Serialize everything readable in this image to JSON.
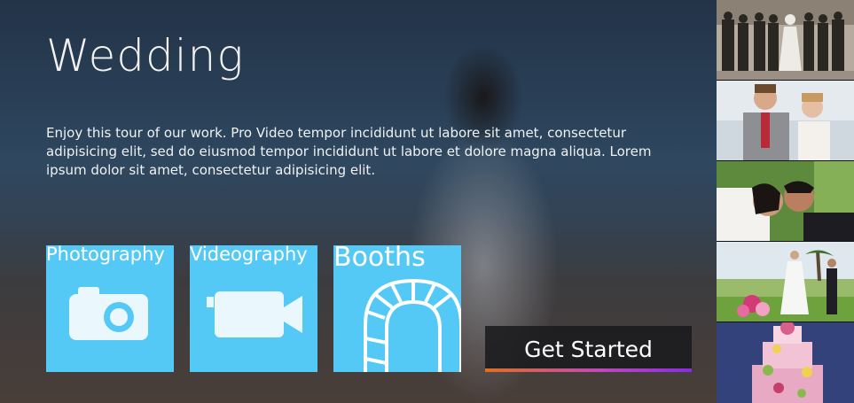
{
  "hero": {
    "title": "Wedding",
    "description": "Enjoy this tour of our work. Pro Video tempor incididunt ut labore sit amet, consectetur adipisicing elit, sed do eiusmod tempor incididunt ut labore et dolore magna aliqua. Lorem ipsum dolor sit amet, consectetur adipisicing elit."
  },
  "tiles": [
    {
      "label": "Photography",
      "icon": "camera-icon"
    },
    {
      "label": "Videography",
      "icon": "video-camera-icon"
    },
    {
      "label": "Booths",
      "icon": "arch-icon"
    }
  ],
  "cta": {
    "label": "Get Started"
  },
  "colors": {
    "tile": "#55c9f6",
    "cta_bar_start": "#e0701e",
    "cta_bar_end": "#8a2be2"
  },
  "thumbnails": [
    "vintage-wedding-group-photo",
    "couple-portrait-photo",
    "couple-kiss-photo",
    "couple-garden-photo",
    "wedding-cake-photo"
  ]
}
